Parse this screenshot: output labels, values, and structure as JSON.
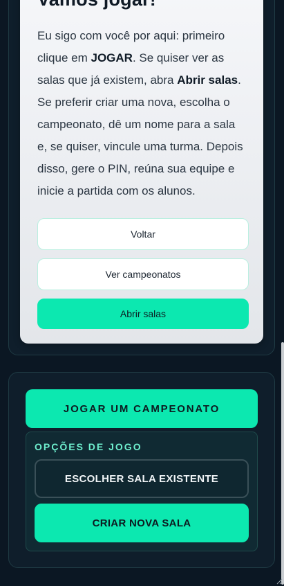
{
  "tutorial": {
    "title": "Vamos jogar!",
    "body_parts": [
      {
        "text": "Eu sigo com você por aqui: primeiro clique em ",
        "bold": false
      },
      {
        "text": "JOGAR",
        "bold": true
      },
      {
        "text": ". Se quiser ver as salas que já existem, abra ",
        "bold": false
      },
      {
        "text": "Abrir salas",
        "bold": true
      },
      {
        "text": ". Se preferir criar uma nova, escolha o campeonato, dê um nome para a sala e, se quiser, vincule uma turma. Depois disso, gere o PIN, reúna sua equipe e inicie a partida com os alunos.",
        "bold": false
      }
    ],
    "back_label": "Voltar",
    "championships_label": "Ver campeonatos",
    "open_rooms_label": "Abrir salas"
  },
  "play": {
    "main_button_label": "JOGAR UM CAMPEONATO",
    "options_label": "OPÇÕES DE JOGO",
    "choose_room_label": "ESCOLHER SALA EXISTENTE",
    "create_room_label": "CRIAR NOVA SALA"
  },
  "colors": {
    "accent": "#0ce8b0",
    "background": "#0b1723",
    "options_label": "#6ff0cf"
  }
}
